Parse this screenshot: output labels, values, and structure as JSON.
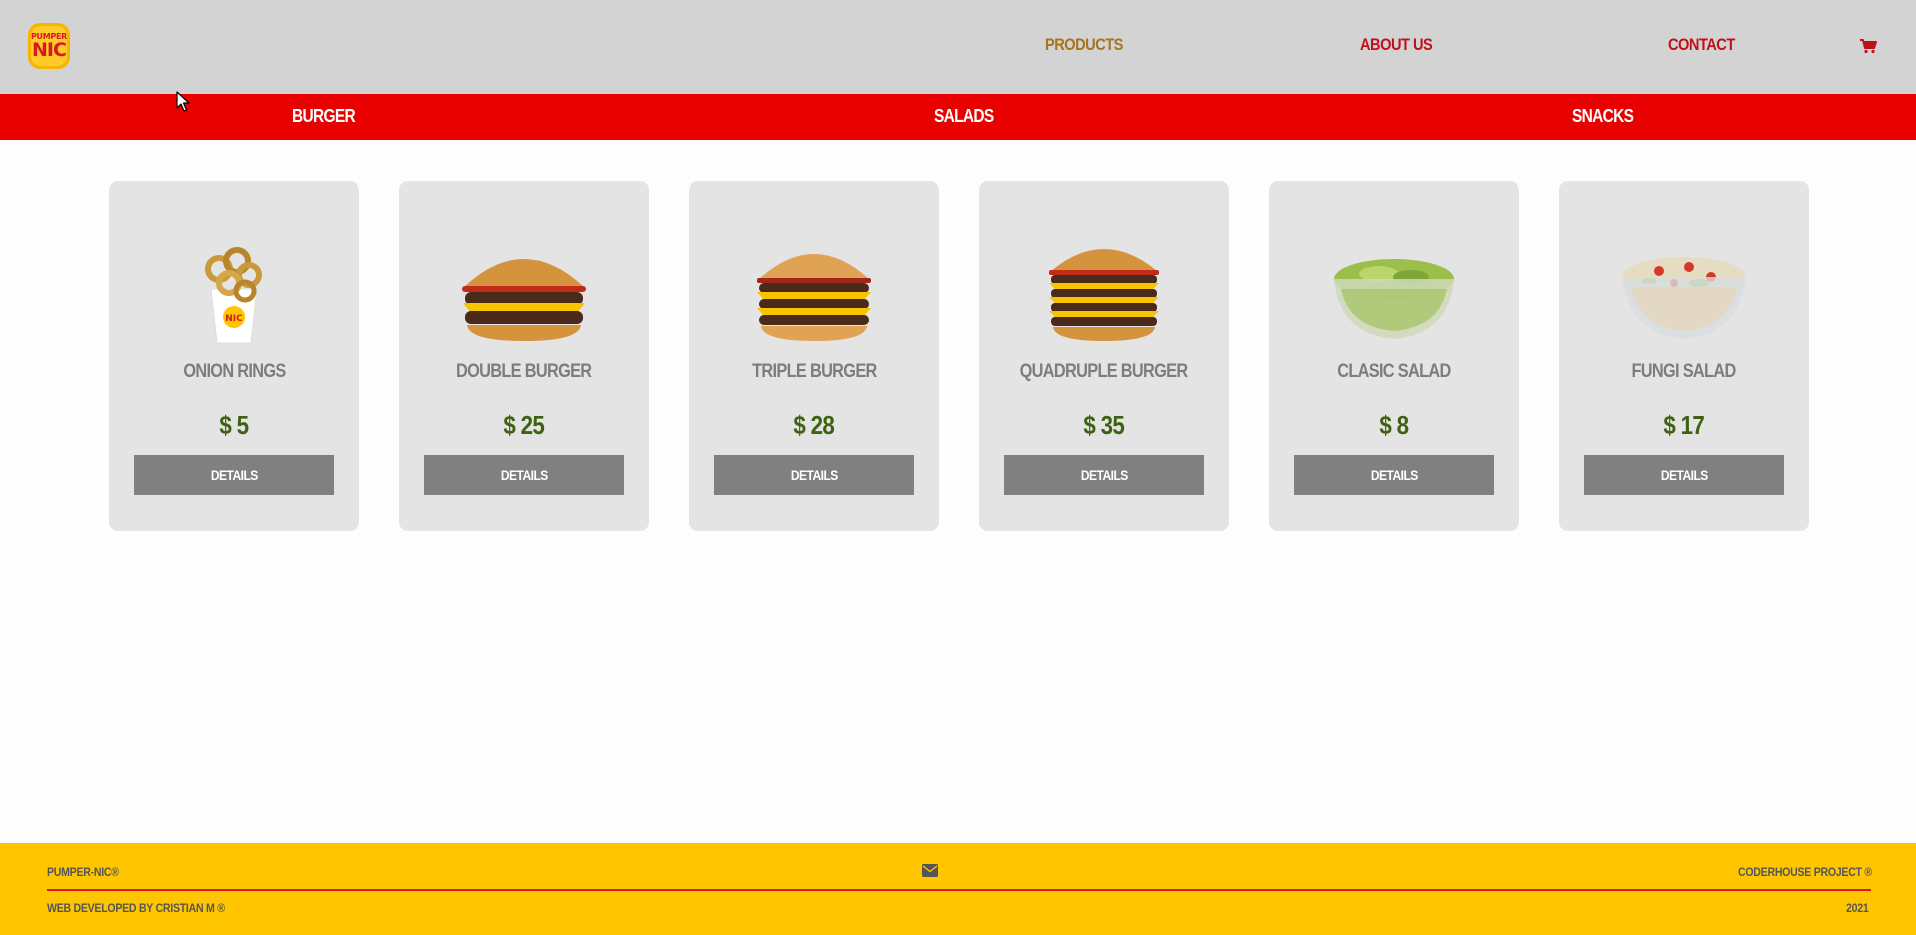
{
  "header": {
    "logo": {
      "top": "PUMPER",
      "bottom": "NIC"
    },
    "nav": {
      "products": "PRODUCTS",
      "about": "ABOUT US",
      "contact": "CONTACT"
    },
    "cart_icon": "shopping-cart-icon"
  },
  "categories": {
    "burger": "BURGER",
    "salads": "SALADS",
    "snacks": "SNACKS"
  },
  "products": [
    {
      "name": "ONION RINGS",
      "price": "$ 5",
      "button": "DETAILS",
      "image": "onion-rings"
    },
    {
      "name": "DOUBLE BURGER",
      "price": "$ 25",
      "button": "DETAILS",
      "image": "double-burger"
    },
    {
      "name": "TRIPLE BURGER",
      "price": "$ 28",
      "button": "DETAILS",
      "image": "triple-burger"
    },
    {
      "name": "QUADRUPLE BURGER",
      "price": "$ 35",
      "button": "DETAILS",
      "image": "quadruple-burger"
    },
    {
      "name": "CLASIC SALAD",
      "price": "$ 8",
      "button": "DETAILS",
      "image": "clasic-salad"
    },
    {
      "name": "FUNGI SALAD",
      "price": "$ 17",
      "button": "DETAILS",
      "image": "fungi-salad"
    }
  ],
  "footer": {
    "brand": "PUMPER-NIC®",
    "developer": "WEB DEVELOPED BY CRISTIAN M ®",
    "project": "CODERHOUSE PROJECT ®",
    "year": "2021",
    "mail_icon": "envelope-icon"
  },
  "colors": {
    "header_bg": "#d3d3d3",
    "category_bar": "#e90000",
    "card_bg": "#e4e4e4",
    "price": "#3f6212",
    "button_bg": "#808080",
    "footer_bg": "#ffc600",
    "nav_active": "#a6741c",
    "nav_link": "#c0111a"
  }
}
